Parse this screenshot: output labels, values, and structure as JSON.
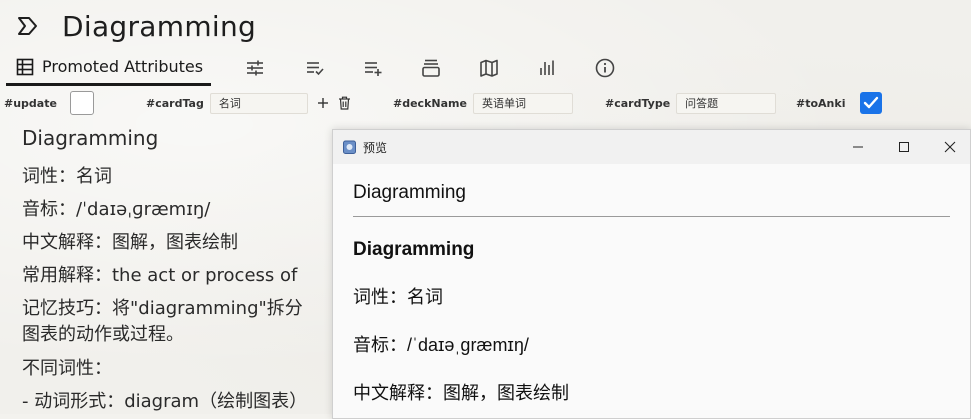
{
  "note": {
    "title": "Diagramming",
    "heading": "Diagramming",
    "lines": [
      "词性：名词",
      "音标：/ˈdaɪəˌɡræmɪŋ/",
      "中文解释：图解，图表绘制",
      "常用解释：the act or process of",
      "记忆技巧：将\"diagramming\"拆分",
      "图表的动作或过程。",
      "不同词性：",
      "- 动词形式：diagram（绘制图表）"
    ]
  },
  "ribbon": {
    "active_tab": "Promoted Attributes",
    "icons": [
      "sliders-icon",
      "checklist-icon",
      "add-list-icon",
      "book-stack-icon",
      "map-icon",
      "bar-chart-icon",
      "info-icon"
    ]
  },
  "attributes": {
    "update_label": "#update",
    "cardtag_label": "#cardTag",
    "cardtag_value": "名词",
    "deckname_label": "#deckName",
    "deckname_value": "英语单词",
    "cardtype_label": "#cardType",
    "cardtype_value": "问答题",
    "toanki_label": "#toAnki",
    "toanki_checked": true,
    "update_checked": false
  },
  "preview": {
    "window_title": "预览",
    "head": "Diagramming",
    "heading": "Diagramming",
    "lines": [
      "词性：名词",
      "音标：/ˈdaɪəˌɡræmɪŋ/",
      "中文解释：图解，图表绘制"
    ]
  },
  "colors": {
    "checkbox_accent": "#1a73e8",
    "background": "#f1f0ec"
  }
}
